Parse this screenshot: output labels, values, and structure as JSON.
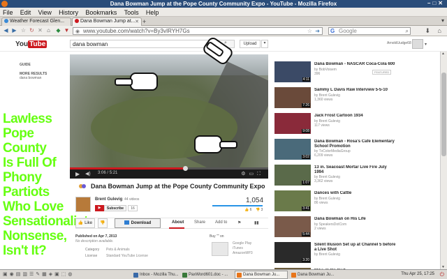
{
  "window": {
    "title": "Dana Bowman Jump at the Pope County Community Expo - YouTube - Mozilla Firefox"
  },
  "menu": [
    "File",
    "Edit",
    "View",
    "History",
    "Bookmarks",
    "Tools",
    "Help"
  ],
  "tabs": [
    {
      "label": "Weather Forecast Glen...",
      "active": false
    },
    {
      "label": "Dana Bowman Jump at...",
      "active": true
    }
  ],
  "nav": {
    "url": "www.youtube.com/watch?v=By3vIRYH7Gs",
    "search_engine": "Google"
  },
  "youtube": {
    "logo_you": "You",
    "logo_tube": "Tube",
    "search_query": "dana bowman",
    "upload_label": "Upload",
    "username": "ArnoldUudge68"
  },
  "guide": {
    "guide_label": "GUIDE",
    "more_results_label": "MORE RESULTS",
    "more_results_sub": "dana bowman"
  },
  "overlay_text": [
    "Lawless",
    "Pope",
    "County",
    "Is Full Of",
    "Phony",
    "Partiots",
    "Who Love",
    "Sensationalist",
    "Nonsense,",
    "Isn't It?"
  ],
  "player": {
    "current_time": "3:06",
    "duration": "5:21",
    "progress_fraction": 0.58
  },
  "video": {
    "title": "Dana Bowman Jump at the Pope County Community Expo",
    "channel": "Brent Gulevig",
    "channel_videos": "44 videos",
    "subscribe_label": "Subscribe",
    "subscriber_count": "16",
    "views": "1,054",
    "likes": "6",
    "dislikes": "3",
    "like_fraction": 0.67,
    "like_label": "Like",
    "download_label": "Download",
    "tabs": [
      "About",
      "Share",
      "Add to"
    ],
    "published": "Published on Apr 7, 2013",
    "description": "No description available.",
    "category_label": "Category",
    "category_value": "Pets & Animals",
    "license_label": "License",
    "license_value": "Standard YouTube License",
    "buy_label": "Buy \"\" on",
    "buy_options": [
      "Google Play",
      "iTunes",
      "AmazonMP3"
    ]
  },
  "related": [
    {
      "title": "Dana Bowman - NASCAR Coca-Cola 600",
      "title2": "",
      "by": "by BobVoisem",
      "views": "396",
      "duration": "4:11",
      "featured": "FEATURED",
      "thumb_color": "#3b4a66"
    },
    {
      "title": "Sammy L Davis Raw Interview 5-5-10",
      "title2": "",
      "by": "by Brent Gulevig",
      "views": "1,360 views",
      "duration": "7:26",
      "featured": "",
      "thumb_color": "#6a4a3a"
    },
    {
      "title": "Jack Frost Cartoon 1934",
      "title2": "",
      "by": "by Brent Gulevig",
      "views": "117 views",
      "duration": "9:08",
      "featured": "",
      "thumb_color": "#8a2a3a"
    },
    {
      "title": "Dana Bowman - Rosa's Cafe Elementary",
      "title2": "School Promotion",
      "by": "by TxColorMediaGroup",
      "views": "6,209 views",
      "duration": "3:02",
      "featured": "",
      "thumb_color": "#4a6a7a"
    },
    {
      "title": "13 in. Seacoast Mortar Live Fire July",
      "title2": "1994",
      "by": "by Brent Gulevig",
      "views": "3,362 views",
      "duration": "1:07",
      "featured": "",
      "thumb_color": "#5a6a4a"
    },
    {
      "title": "Dances with Cattle",
      "title2": "",
      "by": "by Brent Gulevig",
      "views": "86 views",
      "duration": "3:41",
      "featured": "",
      "thumb_color": "#6a7a4a"
    },
    {
      "title": "Dana Bowman on His Life",
      "title2": "",
      "by": "by SpeakersDotCom",
      "views": "2 views",
      "duration": "5:44",
      "featured": "",
      "thumb_color": "#7a5a4a"
    },
    {
      "title": "Silent Illusion Set up at Channel 5 before",
      "title2": "a Live Shot",
      "by": "by Brent Gulevig",
      "views": "",
      "duration": "3:20",
      "featured": "",
      "thumb_color": "#2a2a2a"
    },
    {
      "title": "Mike @ Op Cart",
      "title2": "",
      "by": "",
      "views": "",
      "duration": "",
      "featured": "",
      "thumb_color": "#6a5a3a"
    }
  ],
  "taskbar": {
    "tasks": [
      {
        "label": "Inbox - Mozilla Thu...",
        "active": false,
        "color": "#3a6aa8"
      },
      {
        "label": "PaxWord601.doc - ...",
        "active": false,
        "color": "#3a7a3a"
      },
      {
        "label": "Dana Bowman Ju...",
        "active": true,
        "color": "#e8751a"
      },
      {
        "label": "Dana Bowman Ju...",
        "active": false,
        "color": "#e8751a"
      }
    ],
    "clock": "Thu Apr 25, 17:25"
  }
}
